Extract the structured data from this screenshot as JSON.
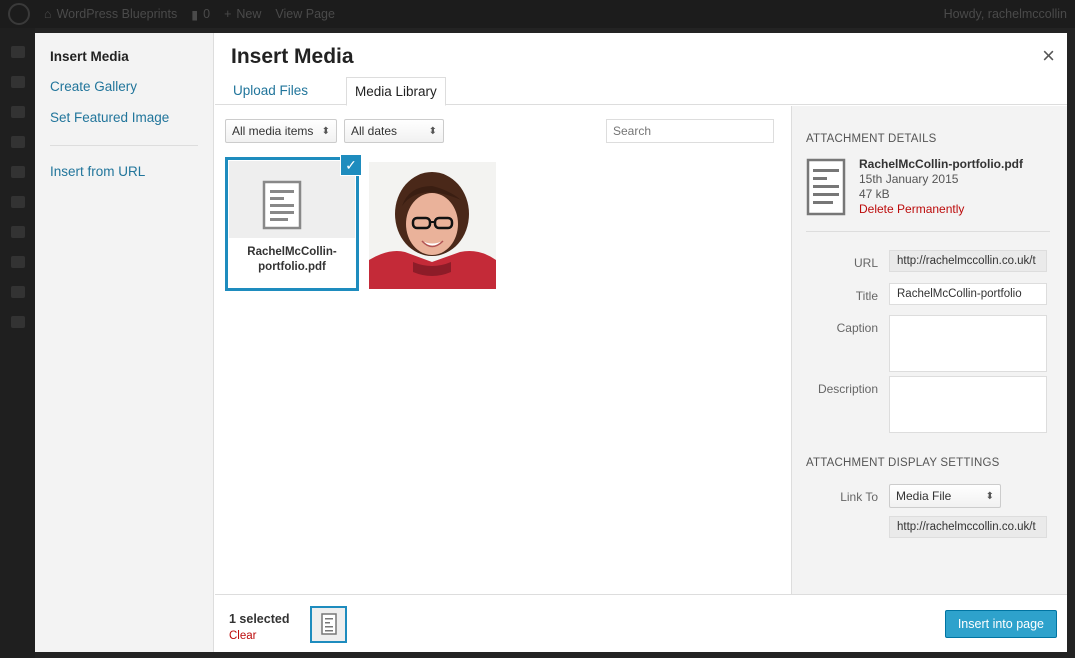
{
  "admin_bar": {
    "site_name": "WordPress Blueprints",
    "comments_count": "0",
    "new_label": "New",
    "view_label": "View Page",
    "howdy": "Howdy, rachelmccollin"
  },
  "modal": {
    "title": "Insert Media",
    "close": "×",
    "menu": [
      "Insert Media",
      "Create Gallery",
      "Set Featured Image",
      "Insert from URL"
    ],
    "tabs": [
      "Upload Files",
      "Media Library"
    ]
  },
  "filters": {
    "media_type": "All media items",
    "dates": "All dates",
    "search_placeholder": "Search"
  },
  "attachments": [
    {
      "filename": "RachelMcCollin-portfolio.pdf",
      "type": "document",
      "selected": true
    },
    {
      "filename": "",
      "type": "photo",
      "selected": false
    }
  ],
  "details": {
    "heading": "Attachment Details",
    "filename": "RachelMcCollin-portfolio.pdf",
    "date": "15th January 2015",
    "size": "47 kB",
    "delete_label": "Delete Permanently",
    "url_label": "URL",
    "url": "http://rachelmccollin.co.uk/t",
    "title_label": "Title",
    "title": "RachelMcCollin-portfolio",
    "caption_label": "Caption",
    "description_label": "Description"
  },
  "display_settings": {
    "heading": "Attachment Display Settings",
    "link_to_label": "Link To",
    "link_to": "Media File",
    "link_url": "http://rachelmccollin.co.uk/t"
  },
  "toolbar": {
    "selected": "1 selected",
    "clear": "Clear",
    "insert": "Insert into page"
  },
  "colors": {
    "accent": "#1e8cbe",
    "button": "#2ea2cc",
    "danger": "#bc0b0b",
    "link": "#21759b"
  }
}
